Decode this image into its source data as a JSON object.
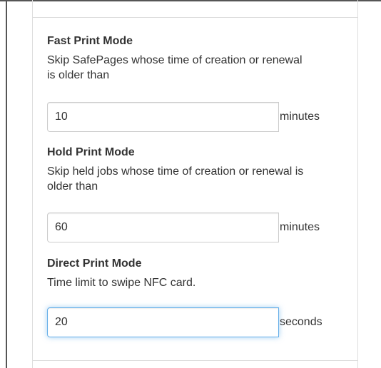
{
  "fast_print": {
    "title": "Fast Print Mode",
    "description_line1": "Skip SafePages whose time of creation or renewal",
    "description_line2": "is older than",
    "value": "10",
    "unit": "minutes"
  },
  "hold_print": {
    "title": "Hold Print Mode",
    "description_line1": "Skip held jobs whose time of creation or renewal is",
    "description_line2": "older than",
    "value": "60",
    "unit": "minutes"
  },
  "direct_print": {
    "title": "Direct Print Mode",
    "description_line1": "Time limit to swipe NFC card.",
    "value": "20",
    "unit": "seconds",
    "focus_color": "#66afe9"
  }
}
